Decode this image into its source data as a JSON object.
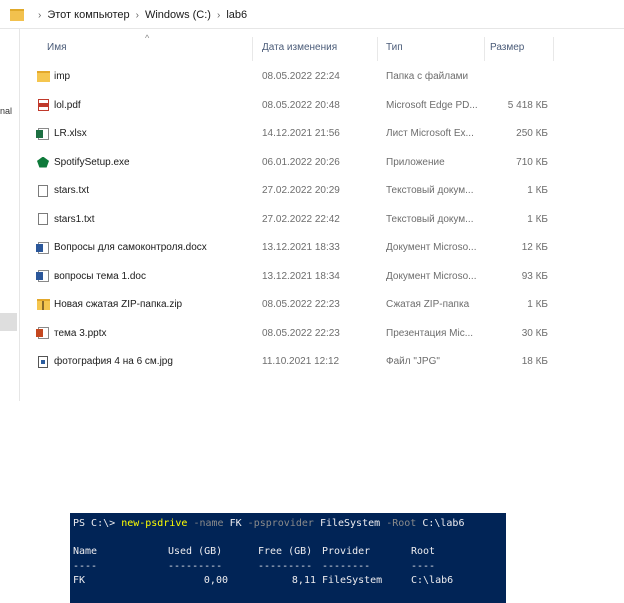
{
  "breadcrumb": [
    "Этот компьютер",
    "Windows (C:)",
    "lab6"
  ],
  "sidebar_cut_text": "nal",
  "columns": {
    "name": "Имя",
    "date": "Дата изменения",
    "type": "Тип",
    "size": "Размер"
  },
  "files": [
    {
      "icon": "folder-icon",
      "name": "imp",
      "date": "08.05.2022 22:24",
      "type": "Папка с файлами",
      "size": ""
    },
    {
      "icon": "pdf-icon",
      "name": "lol.pdf",
      "date": "08.05.2022 20:48",
      "type": "Microsoft Edge PD...",
      "size": "5 418 КБ"
    },
    {
      "icon": "excel-icon",
      "name": "LR.xlsx",
      "date": "14.12.2021 21:56",
      "type": "Лист Microsoft Ex...",
      "size": "250 КБ"
    },
    {
      "icon": "app-icon",
      "name": "SpotifySetup.exe",
      "date": "06.01.2022 20:26",
      "type": "Приложение",
      "size": "710 КБ"
    },
    {
      "icon": "text-file-icon",
      "name": "stars.txt",
      "date": "27.02.2022 20:29",
      "type": "Текстовый докум...",
      "size": "1 КБ"
    },
    {
      "icon": "text-file-icon",
      "name": "stars1.txt",
      "date": "27.02.2022 22:42",
      "type": "Текстовый докум...",
      "size": "1 КБ"
    },
    {
      "icon": "word-icon",
      "name": "Вопросы для самоконтроля.docx",
      "date": "13.12.2021 18:33",
      "type": "Документ Microso...",
      "size": "12 КБ"
    },
    {
      "icon": "word-icon",
      "name": "вопросы тема 1.doc",
      "date": "13.12.2021 18:34",
      "type": "Документ Microso...",
      "size": "93 КБ"
    },
    {
      "icon": "zip-icon",
      "name": "Новая сжатая ZIP-папка.zip",
      "date": "08.05.2022 22:23",
      "type": "Сжатая ZIP-папка",
      "size": "1 КБ"
    },
    {
      "icon": "powerpoint-icon",
      "name": "тема 3.pptx",
      "date": "08.05.2022 22:23",
      "type": "Презентация Mic...",
      "size": "30 КБ"
    },
    {
      "icon": "image-file-icon",
      "name": "фотография 4 на 6 см.jpg",
      "date": "11.10.2021 12:12",
      "type": "Файл \"JPG\"",
      "size": "18 КБ"
    }
  ],
  "terminal": {
    "prompt": "PS C:\\>",
    "cmd": "new-psdrive",
    "p1": "-name",
    "v1": "FK",
    "p2": "-psprovider",
    "v2": "FileSystem",
    "p3": "-Root",
    "v3": "C:\\lab6",
    "headers": [
      "Name",
      "Used (GB)",
      "Free (GB)",
      "Provider",
      "Root"
    ],
    "underlines": [
      "----",
      "---------",
      "---------",
      "--------",
      "----"
    ],
    "row": [
      "FK",
      "0,00",
      "8,11",
      "FileSystem",
      "C:\\lab6"
    ]
  },
  "colors": {
    "terminal_bg": "#012456",
    "command": "#ffff00",
    "param": "#8a8a8a"
  }
}
